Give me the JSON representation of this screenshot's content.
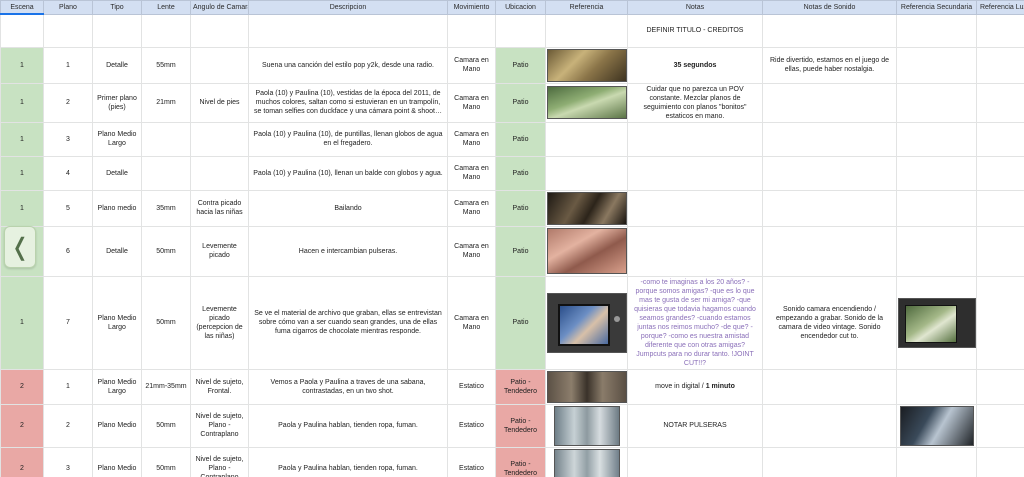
{
  "headers": [
    "Escena",
    "Plano",
    "Tipo",
    "Lente",
    "Angulo de Camara",
    "Descripcion",
    "Movimiento",
    "Ubicacion",
    "Referencia",
    "Notas",
    "Notas de Sonido",
    "Referencia Secundaria",
    "Referencia Luz"
  ],
  "title_row": {
    "notas": "DEFINIR TITULO - CREDITOS"
  },
  "rows": [
    {
      "escena": "1",
      "plano": "1",
      "tipo": "Detalle",
      "lente": "55mm",
      "angulo": "",
      "descripcion": "Suena una canción del estilo pop y2k, desde una radio.",
      "movimiento": "Camara en Mano",
      "ubicacion": "Patio",
      "notas": "35 segundos",
      "sonido": "Ride divertido, estamos en el juego de ellas, puede haber nostalgia."
    },
    {
      "escena": "1",
      "plano": "2",
      "tipo": "Primer plano (pies)",
      "lente": "21mm",
      "angulo": "Nivel de pies",
      "descripcion": "Paola (10) y Paulina (10), vestidas de la época del 2011, de muchos colores, saltan como si estuvieran en un trampolín, se toman selfies con duckface y una cámara point & shoot…",
      "movimiento": "Camara en Mano",
      "ubicacion": "Patio",
      "notas": "Cuidar que no parezca un POV constante. Mezclar planos de seguimiento con planos \"bonitos\" estaticos en mano.",
      "sonido": ""
    },
    {
      "escena": "1",
      "plano": "3",
      "tipo": "Plano Medio Largo",
      "lente": "",
      "angulo": "",
      "descripcion": "Paola (10) y Paulina (10), de puntillas, llenan globos de agua en el fregadero.",
      "movimiento": "Camara en Mano",
      "ubicacion": "Patio",
      "notas": "",
      "sonido": ""
    },
    {
      "escena": "1",
      "plano": "4",
      "tipo": "Detalle",
      "lente": "",
      "angulo": "",
      "descripcion": "Paola (10) y Paulina (10), llenan un balde con globos y agua.",
      "movimiento": "Camara en Mano",
      "ubicacion": "Patio",
      "notas": "",
      "sonido": ""
    },
    {
      "escena": "1",
      "plano": "5",
      "tipo": "Plano medio",
      "lente": "35mm",
      "angulo": "Contra picado hacia las niñas",
      "descripcion": "Bailando",
      "movimiento": "Camara en Mano",
      "ubicacion": "Patio",
      "notas": "",
      "sonido": ""
    },
    {
      "escena": "1",
      "plano": "6",
      "tipo": "Detalle",
      "lente": "50mm",
      "angulo": "Levemente picado",
      "descripcion": "Hacen e intercambian pulseras.",
      "movimiento": "Camara en Mano",
      "ubicacion": "Patio",
      "notas": "",
      "sonido": ""
    },
    {
      "escena": "1",
      "plano": "7",
      "tipo": "Plano Medio Largo",
      "lente": "50mm",
      "angulo": "Levemente picado (percepcion de las niñas)",
      "descripcion": "Se ve el material de archivo que graban, ellas se entrevistan sobre cómo van a ser cuando sean grandes, una de ellas fuma cigarros de chocolate mientras responde.",
      "movimiento": "Camara en Mano",
      "ubicacion": "Patio",
      "notas": "-como te imaginas a los 20 años? -porque somos amigas? -que es lo que mas te gusta de ser mi amiga? -que quisieras que todavia hagamos cuando seamos grandes? -cuando estamos juntas nos reimos mucho? -de que? -porque? -como es nuestra amistad diferente que con otras amigas? Jumpcuts para no durar tanto. !JOINT CUT!!?",
      "sonido": "Sonido camara encendiendo / empezando a grabar. Sonido de la camara de video vintage. Sonido encendedor cut to."
    },
    {
      "escena": "2",
      "plano": "1",
      "tipo": "Plano Medio Largo",
      "lente": "21mm-35mm",
      "angulo": "Nivel de sujeto, Frontal.",
      "descripcion": "Vemos a Paola y Paulina a traves de una sabana, contrastadas, en un two shot.",
      "movimiento": "Estatico",
      "ubicacion": "Patio - Tendedero",
      "notas_a": "move in digital / ",
      "notas_b": "1 minuto",
      "sonido": ""
    },
    {
      "escena": "2",
      "plano": "2",
      "tipo": "Plano Medio",
      "lente": "50mm",
      "angulo": "Nivel de sujeto, Plano - Contraplano",
      "descripcion": "Paola y Paulina hablan, tienden ropa, fuman.",
      "movimiento": "Estatico",
      "ubicacion": "Patio - Tendedero",
      "notas": "NOTAR PULSERAS",
      "sonido": ""
    },
    {
      "escena": "2",
      "plano": "3",
      "tipo": "Plano Medio",
      "lente": "50mm",
      "angulo": "Nivel de sujeto, Plano - Contraplano",
      "descripcion": "Paola y Paulina hablan, tienden ropa, fuman.",
      "movimiento": "Estatico",
      "ubicacion": "Patio - Tendedero",
      "notas": "",
      "sonido": ""
    }
  ],
  "nav": {
    "icon": "chevron-left-icon",
    "glyph": "❬"
  },
  "colors": {
    "scene1": "#c8e2c2",
    "scene2": "#e9a8a5",
    "header": "#d3dff2",
    "notes_purple": "#8a6fb9"
  }
}
